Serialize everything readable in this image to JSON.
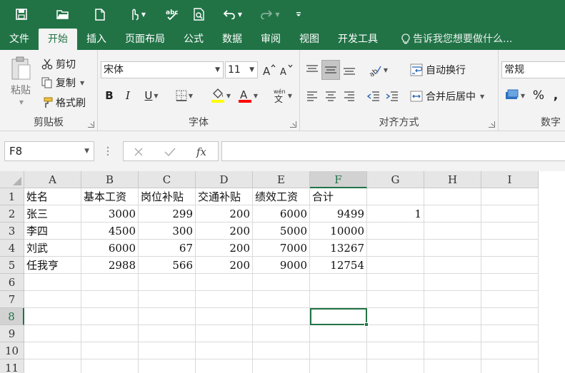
{
  "quick_access": {
    "save": "save-icon",
    "open": "open-folder-icon",
    "new": "new-document-icon",
    "touch": "touch-mode-icon",
    "spell": "spell-check-icon",
    "preview": "print-preview-icon",
    "undo": "undo-icon",
    "redo": "redo-icon",
    "customize": "customize-icon"
  },
  "tabs": [
    "文件",
    "开始",
    "插入",
    "页面布局",
    "公式",
    "数据",
    "审阅",
    "视图",
    "开发工具"
  ],
  "active_tab": 1,
  "tell_me": "告诉我您想要做什么...",
  "clipboard": {
    "paste": "粘贴",
    "cut": "剪切",
    "copy": "复制",
    "format_painter": "格式刷",
    "label": "剪贴板"
  },
  "font": {
    "name": "宋体",
    "size": "11",
    "bold": "B",
    "italic": "I",
    "underline": "U",
    "label": "字体",
    "fill_color": "#ffff00",
    "font_color": "#ff0000"
  },
  "alignment": {
    "wrap_text": "自动换行",
    "merge_center": "合并后居中",
    "label": "对齐方式"
  },
  "number": {
    "format": "常规",
    "percent": "%",
    "label": "数字"
  },
  "formula_bar": {
    "name_box": "F8",
    "fx": "fx",
    "value": ""
  },
  "columns": [
    "A",
    "B",
    "C",
    "D",
    "E",
    "F",
    "G",
    "H",
    "I"
  ],
  "selected_column": "F",
  "rows": [
    "1",
    "2",
    "3",
    "4",
    "5",
    "6",
    "7",
    "8",
    "9",
    "10",
    "11"
  ],
  "selected_row": "8",
  "sheet": [
    [
      "姓名",
      "基本工资",
      "岗位补贴",
      "交通补贴",
      "绩效工资",
      "合计",
      "",
      "",
      ""
    ],
    [
      "张三",
      "3000",
      "299",
      "200",
      "6000",
      "9499",
      "1",
      "",
      ""
    ],
    [
      "李四",
      "4500",
      "300",
      "200",
      "5000",
      "10000",
      "",
      "",
      ""
    ],
    [
      "刘武",
      "6000",
      "67",
      "200",
      "7000",
      "13267",
      "",
      "",
      ""
    ],
    [
      "任我亨",
      "2988",
      "566",
      "200",
      "9000",
      "12754",
      "",
      "",
      ""
    ]
  ],
  "colors": {
    "brand": "#217346",
    "ribbon": "#f3f3f3"
  }
}
